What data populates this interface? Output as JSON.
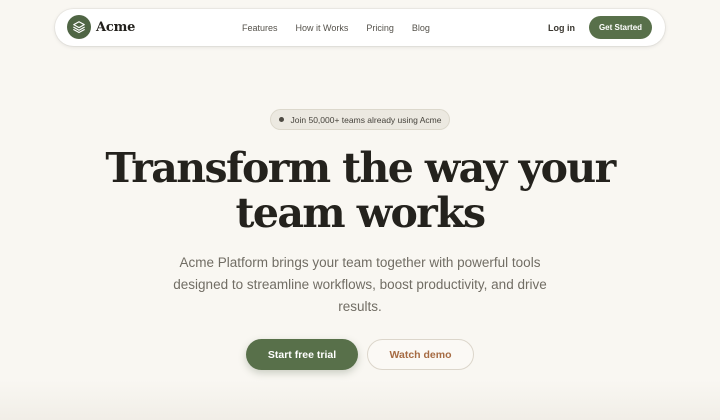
{
  "nav": {
    "brand_name": "Acme",
    "links": [
      "Features",
      "How it Works",
      "Pricing",
      "Blog"
    ],
    "login_label": "Log in",
    "cta_label": "Get Started"
  },
  "hero": {
    "badge_text": "Join 50,000+ teams already using Acme",
    "headline_line1": "Transform the way your",
    "headline_line2": "team works",
    "subtitle": "Acme Platform brings your team together with powerful tools designed to streamline workflows, boost productivity, and drive results.",
    "primary_cta": "Start free trial",
    "secondary_cta": "Watch demo"
  },
  "colors": {
    "background": "#f9f7f2",
    "brand_green": "#58704a",
    "accent_brown": "#a66b43",
    "heading": "#24221d"
  },
  "icons": {
    "logo": "layers-icon",
    "badge": "dot-icon"
  }
}
